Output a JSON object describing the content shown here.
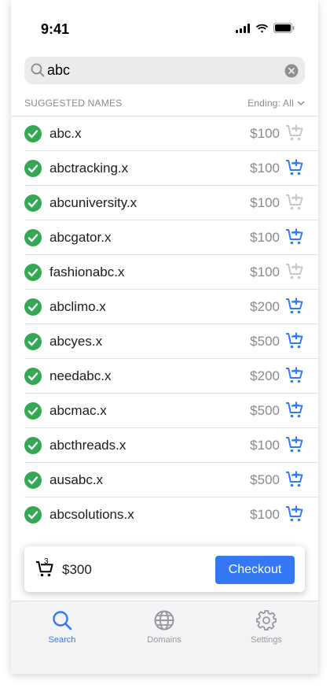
{
  "status_bar": {
    "time": "9:41"
  },
  "search": {
    "value": "abc"
  },
  "section": {
    "title": "SUGGESTED NAMES",
    "filter_label": "Ending: All"
  },
  "results": [
    {
      "name": "abc.x",
      "price": "$100",
      "in_cart": true
    },
    {
      "name": "abctracking.x",
      "price": "$100",
      "in_cart": false
    },
    {
      "name": "abcuniversity.x",
      "price": "$100",
      "in_cart": true
    },
    {
      "name": "abcgator.x",
      "price": "$100",
      "in_cart": false
    },
    {
      "name": "fashionabc.x",
      "price": "$100",
      "in_cart": true
    },
    {
      "name": "abclimo.x",
      "price": "$200",
      "in_cart": false
    },
    {
      "name": "abcyes.x",
      "price": "$500",
      "in_cart": false
    },
    {
      "name": "needabc.x",
      "price": "$200",
      "in_cart": false
    },
    {
      "name": "abcmac.x",
      "price": "$500",
      "in_cart": false
    },
    {
      "name": "abcthreads.x",
      "price": "$100",
      "in_cart": false
    },
    {
      "name": "ausabc.x",
      "price": "$500",
      "in_cart": false
    },
    {
      "name": "abcsolutions.x",
      "price": "$100",
      "in_cart": false
    }
  ],
  "cart": {
    "count": "3",
    "total": "$300",
    "checkout_label": "Checkout"
  },
  "tabs": [
    {
      "label": "Search",
      "icon": "search-icon",
      "active": true
    },
    {
      "label": "Domains",
      "icon": "globe-icon",
      "active": false
    },
    {
      "label": "Settings",
      "icon": "gear-icon",
      "active": false
    }
  ],
  "colors": {
    "accent": "#3478f6",
    "success": "#34a853",
    "muted": "#8a8a8e"
  }
}
